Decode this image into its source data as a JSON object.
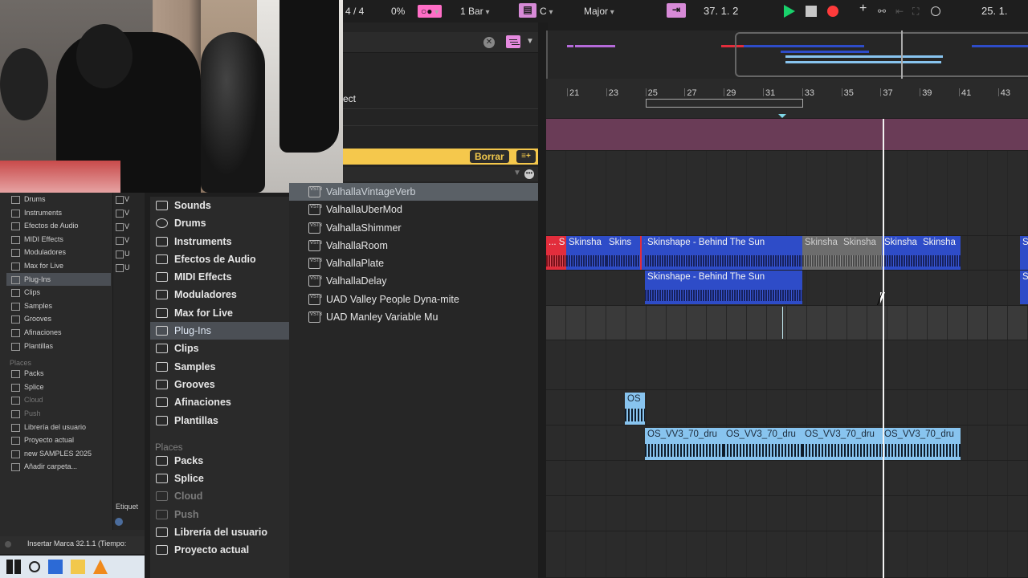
{
  "transport": {
    "time_signature": "4 / 4",
    "groove_pct": "0%",
    "quantize": "1 Bar",
    "key": "C",
    "scale": "Major",
    "follow_icon": "follow-arrow-icon",
    "position": "37.   1.   2",
    "loop_start": "25.   1.",
    "play_color": "#19d16b",
    "record_color": "#ff3b3b"
  },
  "browser": {
    "tag_text": "ect",
    "borrar_label": "Borrar",
    "add_tag_label": "≡+",
    "categories": [
      "Sounds",
      "Drums",
      "Instruments",
      "Efectos de Audio",
      "MIDI Effects",
      "Moduladores",
      "Max for Live",
      "Plug-Ins",
      "Clips",
      "Samples",
      "Grooves",
      "Afinaciones",
      "Plantillas"
    ],
    "selected_category": "Plug-Ins",
    "places_label": "Places",
    "places": [
      "Packs",
      "Splice",
      "Cloud",
      "Push",
      "Librería del usuario",
      "Proyecto actual"
    ],
    "plugins": [
      "ValhallaVintageVerb",
      "ValhallaUberMod",
      "ValhallaShimmer",
      "ValhallaRoom",
      "ValhallaPlate",
      "ValhallaDelay",
      "UAD Valley People Dyna-mite",
      "UAD Manley Variable Mu"
    ],
    "plugin_badge": "VST3"
  },
  "background_browser": {
    "categories": [
      "Drums",
      "Instruments",
      "Efectos de Audio",
      "MIDI Effects",
      "Moduladores",
      "Max for Live",
      "Plug-Ins",
      "Clips",
      "Samples",
      "Grooves",
      "Afinaciones",
      "Plantillas"
    ],
    "places_label": "Places",
    "places": [
      "Packs",
      "Splice",
      "Cloud",
      "Push",
      "Librería del usuario",
      "Proyecto actual",
      "new SAMPLES 2025",
      "Añadir carpeta..."
    ],
    "column2": [
      "V",
      "V",
      "V",
      "V",
      "U",
      "U"
    ],
    "etiquetas": "Etiquet",
    "status_text": "Insertar Marca 32.1.1 (Tiempo:"
  },
  "arrangement": {
    "ruler_ticks": [
      "21",
      "23",
      "25",
      "27",
      "29",
      "31",
      "33",
      "35",
      "37",
      "39",
      "41",
      "43"
    ],
    "clips": {
      "red_clip": "... S",
      "skinsha_1": "Skinsha",
      "skins_2": "Skins",
      "s_3": "S",
      "behind_sun_1": "Skinshape - Behind The Sun",
      "skinsha_grey_1": "Skinsha",
      "skinsha_grey_2": "Skinsha",
      "skinsha_4": "Skinsha",
      "skinshap_5": "Skinsha",
      "s_right_1": "S",
      "behind_sun_2": "Skinshape - Behind The Sun",
      "s_right_2": "S",
      "os_small": "OS",
      "os_vv3_1": "OS_VV3_70_dru",
      "os_vv3_2": "OS_VV3_70_dru",
      "os_vv3_3": "OS_VV3_70_dru",
      "os_vv3_4": "OS_VV3_70_dru"
    }
  }
}
